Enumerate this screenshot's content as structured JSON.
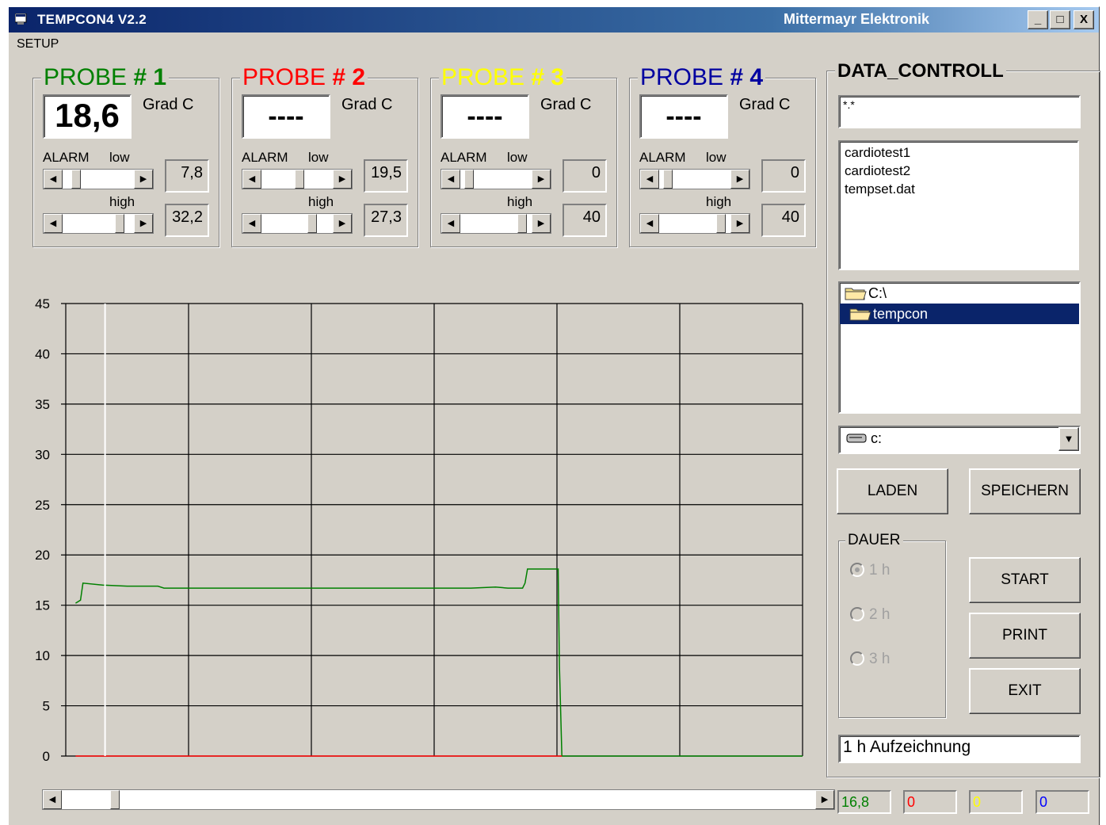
{
  "window": {
    "title": "TEMPCON4  V2.2",
    "vendor": "Mittermayr Elektronik",
    "controls": [
      "_",
      "□",
      "X"
    ]
  },
  "menu": {
    "setup": "SETUP"
  },
  "probe_unit": "Grad C",
  "alarm_labels": {
    "alarm": "ALARM",
    "low": "low",
    "high": "high"
  },
  "probes": [
    {
      "title": "PROBE",
      "number": "# 1",
      "title_color": "#008000",
      "number_color": "#008000",
      "reading": "18,6",
      "low": "7,8",
      "high": "32,2"
    },
    {
      "title": "PROBE",
      "number": "# 2",
      "title_color": "#ff0000",
      "number_color": "#ff0000",
      "reading": "----",
      "low": "19,5",
      "high": "27,3"
    },
    {
      "title": "PROBE",
      "number": "# 3",
      "title_color": "#ffff00",
      "number_color": "#ffff00",
      "reading": "----",
      "low": "0",
      "high": "40"
    },
    {
      "title": "PROBE",
      "number": "# 4",
      "title_color": "#0000a0",
      "number_color": "#0000a0",
      "reading": "----",
      "low": "0",
      "high": "40"
    }
  ],
  "data_control": {
    "title": "DATA_CONTROLL",
    "filter": "*.*",
    "files": [
      "cardiotest1",
      "cardiotest2",
      "tempset.dat"
    ],
    "dirs": [
      {
        "name": "C:\\",
        "selected": false
      },
      {
        "name": "tempcon",
        "selected": true
      }
    ],
    "drive": "c:",
    "load_button": "LADEN",
    "save_button": "SPEICHERN",
    "duration_title": "DAUER",
    "durations": [
      {
        "label": "1 h",
        "checked": true
      },
      {
        "label": "2 h",
        "checked": false
      },
      {
        "label": "3 h",
        "checked": false
      }
    ],
    "start_button": "START",
    "print_button": "PRINT",
    "exit_button": "EXIT",
    "status": "1 h Aufzeichnung"
  },
  "status_values": [
    {
      "value": "16,8",
      "color": "#008000"
    },
    {
      "value": "0",
      "color": "#ff0000"
    },
    {
      "value": "0",
      "color": "#ffff00"
    },
    {
      "value": "0",
      "color": "#0000ff"
    }
  ],
  "icons": {
    "app": "app-window-icon",
    "folder": "folder-icon",
    "drive": "drive-icon",
    "dropdown": "chevron-down-icon",
    "scroll_left": "arrow-left-icon",
    "scroll_right": "arrow-right-icon"
  },
  "chart_data": {
    "type": "line",
    "yticks": [
      "0",
      "5",
      "10",
      "15",
      "20",
      "25",
      "30",
      "35",
      "40",
      "45"
    ],
    "ylim": [
      0,
      45
    ],
    "xlim": [
      0,
      6
    ],
    "x_gridlines": 6,
    "grid": true,
    "background": "#d4d0c8",
    "cursor_x": 0.32,
    "series": [
      {
        "color": "#008000",
        "points": [
          [
            0.08,
            15.2
          ],
          [
            0.12,
            15.5
          ],
          [
            0.14,
            17.2
          ],
          [
            0.3,
            17.0
          ],
          [
            0.5,
            16.9
          ],
          [
            0.75,
            16.9
          ],
          [
            0.8,
            16.7
          ],
          [
            1.5,
            16.7
          ],
          [
            2.5,
            16.7
          ],
          [
            3.3,
            16.7
          ],
          [
            3.5,
            16.8
          ],
          [
            3.6,
            16.7
          ],
          [
            3.72,
            16.7
          ],
          [
            3.74,
            17.2
          ],
          [
            3.76,
            18.6
          ],
          [
            4.01,
            18.6
          ],
          [
            4.02,
            9.0
          ],
          [
            4.04,
            0.0
          ],
          [
            6.0,
            0.0
          ]
        ]
      },
      {
        "color": "#ff0000",
        "points": [
          [
            0.08,
            0.0
          ],
          [
            4.04,
            0.0
          ]
        ]
      }
    ]
  },
  "time_scroll": {
    "position": 0.065
  }
}
